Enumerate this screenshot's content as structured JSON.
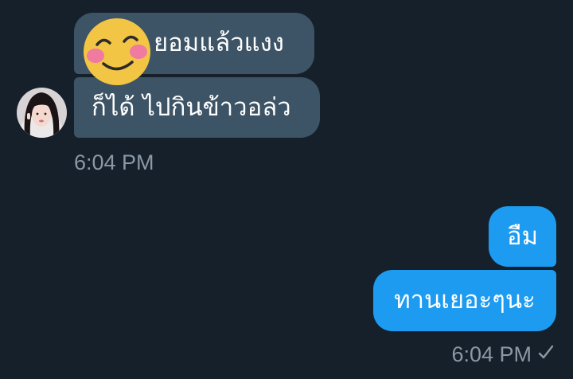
{
  "received": {
    "messages": [
      {
        "text": "ยอมแล้วแงง",
        "sticker": "smiling-blush-emoji"
      },
      {
        "text": "ก็ได้ ไปกินข้าวอล่ว"
      }
    ],
    "timestamp": "6:04 PM",
    "bubble_color": "#3d5466"
  },
  "sent": {
    "messages": [
      {
        "text": "อืม"
      },
      {
        "text": "ทานเยอะๆนะ"
      }
    ],
    "timestamp": "6:04 PM",
    "status_icon": "checkmark-icon",
    "bubble_color": "#1d9bf0"
  },
  "theme": {
    "background": "#15202b",
    "timestamp_color": "#8b98a5"
  }
}
